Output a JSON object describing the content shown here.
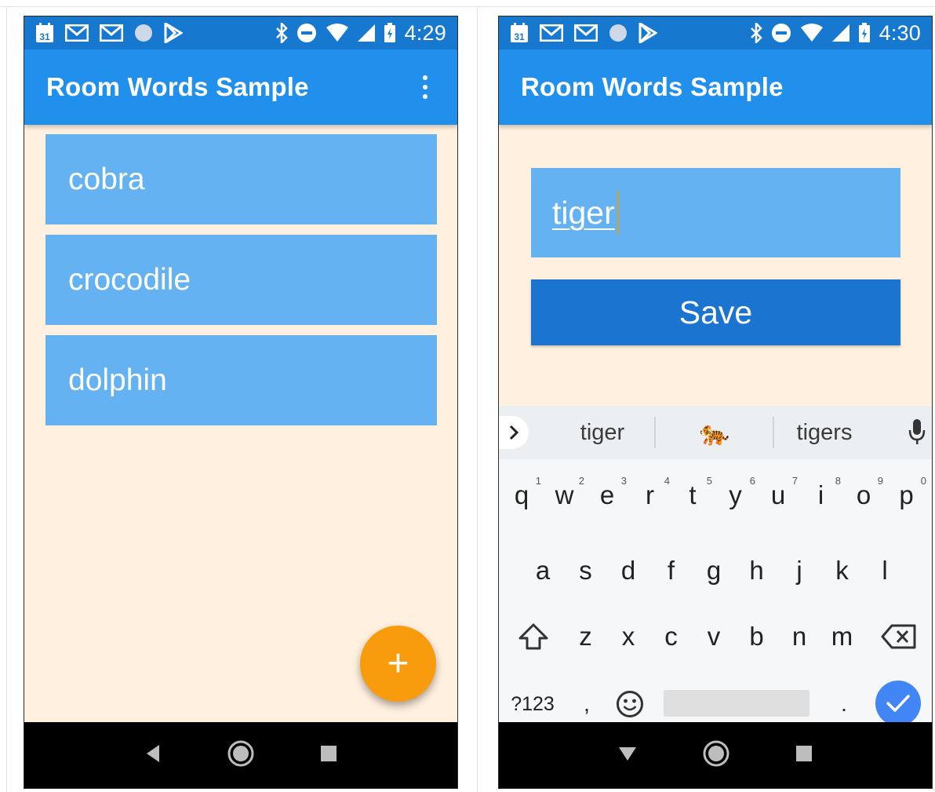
{
  "screen_left": {
    "status": {
      "time": "4:29",
      "icons_left": [
        "calendar-icon",
        "gmail-icon",
        "gmail-icon",
        "circle-icon",
        "play-store-icon"
      ],
      "icons_right": [
        "bluetooth-icon",
        "do-not-disturb-icon",
        "wifi-icon",
        "signal-icon",
        "battery-icon"
      ]
    },
    "app_bar": {
      "title": "Room Words Sample",
      "menu_icon": "overflow-menu-icon"
    },
    "words": [
      "cobra",
      "crocodile",
      "dolphin"
    ],
    "fab": {
      "label": "+"
    },
    "nav": [
      "back-icon",
      "home-icon",
      "recents-icon"
    ]
  },
  "screen_right": {
    "status": {
      "time": "4:30",
      "icons_left": [
        "calendar-icon",
        "gmail-icon",
        "gmail-icon",
        "circle-icon",
        "play-store-icon"
      ],
      "icons_right": [
        "bluetooth-icon",
        "do-not-disturb-icon",
        "wifi-icon",
        "signal-icon",
        "battery-icon"
      ]
    },
    "app_bar": {
      "title": "Room Words Sample"
    },
    "edit": {
      "value": "tiger"
    },
    "save_label": "Save",
    "keyboard": {
      "suggestions": [
        "tiger",
        "🐅",
        "tigers"
      ],
      "row1": [
        "q",
        "w",
        "e",
        "r",
        "t",
        "y",
        "u",
        "i",
        "o",
        "p"
      ],
      "row1_hints": [
        "1",
        "2",
        "3",
        "4",
        "5",
        "6",
        "7",
        "8",
        "9",
        "0"
      ],
      "row2": [
        "a",
        "s",
        "d",
        "f",
        "g",
        "h",
        "j",
        "k",
        "l"
      ],
      "row3": [
        "z",
        "x",
        "c",
        "v",
        "b",
        "n",
        "m"
      ],
      "bottom": {
        "symbols": "?123",
        "comma": ",",
        "period": "."
      }
    },
    "nav": [
      "back-down-icon",
      "home-icon",
      "recents-icon"
    ]
  },
  "colors": {
    "status_bar": "#1778d0",
    "app_bar": "#2190ec",
    "list_item": "#64b2f2",
    "background": "#fff0df",
    "fab": "#f89c0d",
    "save_button": "#1b74cf",
    "enter_key": "#4285f4"
  }
}
